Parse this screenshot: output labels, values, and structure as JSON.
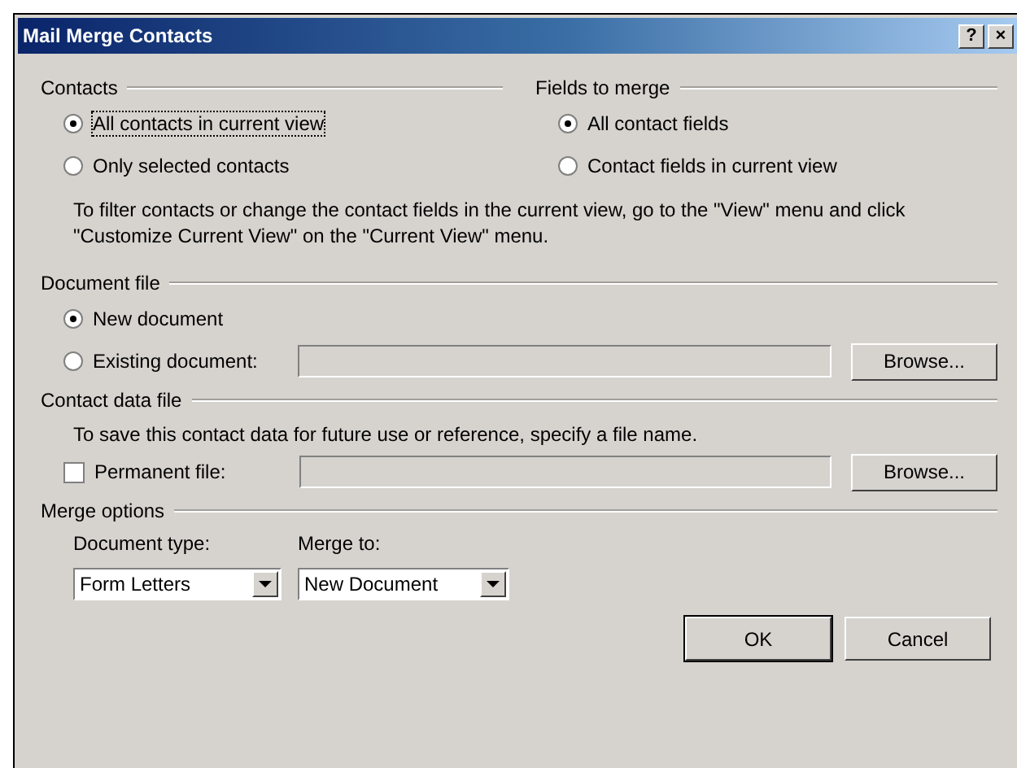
{
  "window": {
    "title": "Mail Merge Contacts",
    "title_buttons": [
      "?",
      "×"
    ]
  },
  "contacts": {
    "heading": "Contacts",
    "options": [
      {
        "label": "All contacts in current view",
        "selected": true
      },
      {
        "label": "Only selected contacts",
        "selected": false
      }
    ]
  },
  "fields_to_merge": {
    "heading": "Fields to merge",
    "options": [
      {
        "label": "All contact fields",
        "selected": true
      },
      {
        "label": "Contact fields in current view",
        "selected": false
      }
    ]
  },
  "filter_note": "To filter contacts or change the contact fields in the current view, go to the \"View\" menu and click \"Customize Current View\" on the \"Current View\" menu.",
  "document_file": {
    "heading": "Document file",
    "options": [
      {
        "label": "New document",
        "selected": true
      },
      {
        "label": "Existing document:",
        "selected": false
      }
    ],
    "field": {
      "disabled": true
    },
    "browse": "Browse..."
  },
  "contact_data_file": {
    "heading": "Contact data file",
    "note": "To save this contact data for future use or reference, specify a file name.",
    "checkbox": {
      "label": "Permanent file:",
      "checked": false
    },
    "field": {
      "disabled": true
    },
    "browse": "Browse..."
  },
  "merge_options": {
    "heading": "Merge options",
    "selects": [
      {
        "label": "Document type:",
        "value": "Form Letters"
      },
      {
        "label": "Merge to:",
        "value": "New Document"
      }
    ]
  },
  "buttons": [
    "OK",
    "Cancel"
  ]
}
